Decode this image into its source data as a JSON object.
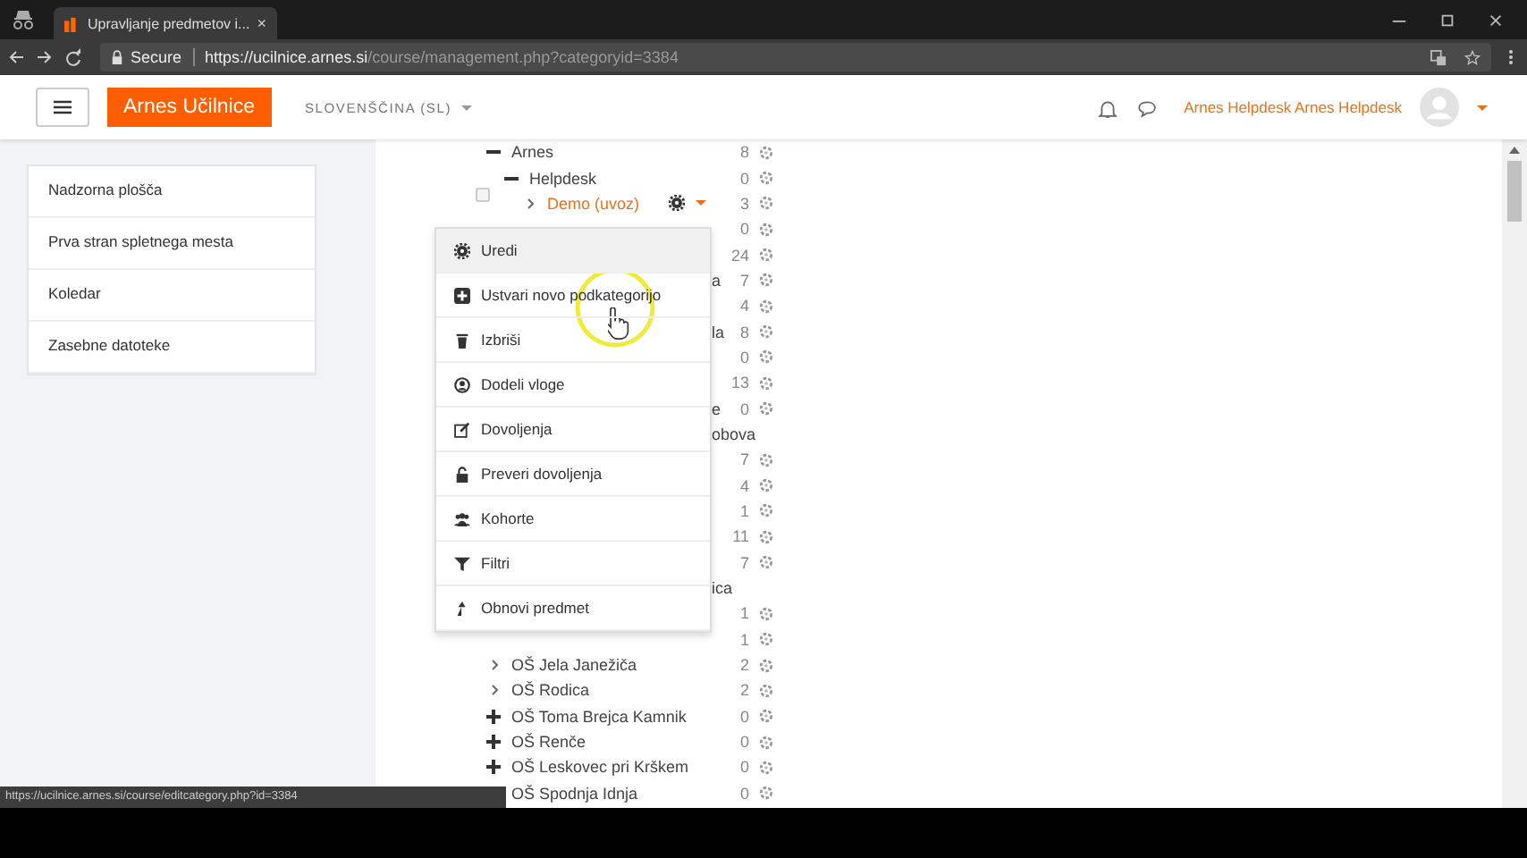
{
  "browser": {
    "tab_title": "Upravljanje predmetov i...",
    "tab_close": "×",
    "secure_label": "Secure",
    "url_host": "https://ucilnice.arnes.si",
    "url_path": "/course/management.php?categoryid=3384",
    "status_url": "https://ucilnice.arnes.si/course/editcategory.php?id=3384"
  },
  "header": {
    "logo": "Arnes Učilnice",
    "language": "SLOVENŠČINA (SL)",
    "user_name": "Arnes Helpdesk Arnes Helpdesk"
  },
  "sidebar": {
    "items": [
      {
        "label": "Nadzorna plošča"
      },
      {
        "label": "Prva stran spletnega mesta"
      },
      {
        "label": "Koledar"
      },
      {
        "label": "Zasebne datoteke"
      }
    ]
  },
  "tree": {
    "items": [
      {
        "kind": "minus",
        "name": "Arnes",
        "count": "8",
        "selected": false,
        "children": [
          {
            "kind": "minus",
            "name": "Helpdesk",
            "count": "0",
            "selected": false,
            "children": [
              {
                "kind": "expand",
                "name": "Demo (uvoz)",
                "count": "3",
                "selected": true,
                "checked": false
              }
            ]
          }
        ]
      },
      {
        "kind": "hidden",
        "count": "0"
      },
      {
        "kind": "hidden",
        "count": "24"
      },
      {
        "kind": "hidden",
        "name": "a",
        "count": "7",
        "selected": false
      },
      {
        "kind": "hidden",
        "count": "4"
      },
      {
        "kind": "hidden",
        "name": "la",
        "count": "8",
        "selected": false
      },
      {
        "kind": "hidden",
        "count": "0"
      },
      {
        "kind": "hidden",
        "count": "13"
      },
      {
        "kind": "hidden",
        "name": "e",
        "count": "0",
        "selected": false
      },
      {
        "kind": "hidden",
        "name": "obova",
        "selected": false
      },
      {
        "kind": "hidden",
        "count": "7"
      },
      {
        "kind": "hidden",
        "count": "4"
      },
      {
        "kind": "hidden",
        "count": "1"
      },
      {
        "kind": "hidden",
        "count": "11"
      },
      {
        "kind": "hidden",
        "count": "7"
      },
      {
        "kind": "hidden",
        "name": "ica",
        "selected": false
      },
      {
        "kind": "hidden",
        "count": "1"
      },
      {
        "kind": "hidden",
        "count": "1"
      },
      {
        "kind": "expand",
        "name": "OŠ Jela Janežiča",
        "count": "2",
        "selected": false
      },
      {
        "kind": "expand",
        "name": "OŠ Rodica",
        "count": "2",
        "selected": false
      },
      {
        "kind": "plus",
        "name": "OŠ Toma Brejca Kamnik",
        "count": "0",
        "selected": false
      },
      {
        "kind": "plus",
        "name": "OŠ Renče",
        "count": "0",
        "selected": false
      },
      {
        "kind": "plus",
        "name": "OŠ Leskovec pri Krškem",
        "count": "0",
        "selected": false
      },
      {
        "kind": "none",
        "name": "OŠ Spodnja Idnja",
        "count": "0",
        "selected": false
      }
    ]
  },
  "menu": {
    "items": [
      {
        "kind": "gear",
        "label": "Uredi",
        "selected": true
      },
      {
        "kind": "plus",
        "label": "Ustvari novo podkategorijo",
        "selected": false
      },
      {
        "kind": "trash",
        "label": "Izbriši",
        "selected": false
      },
      {
        "kind": "user",
        "label": "Dodeli vloge",
        "selected": false
      },
      {
        "kind": "edit",
        "label": "Dovoljenja",
        "selected": false
      },
      {
        "kind": "lock",
        "label": "Preveri dovoljenja",
        "selected": false
      },
      {
        "kind": "users",
        "label": "Kohorte",
        "selected": false
      },
      {
        "kind": "filter",
        "label": "Filtri",
        "selected": false
      },
      {
        "kind": "restore",
        "label": "Obnovi predmet",
        "selected": false
      }
    ]
  }
}
